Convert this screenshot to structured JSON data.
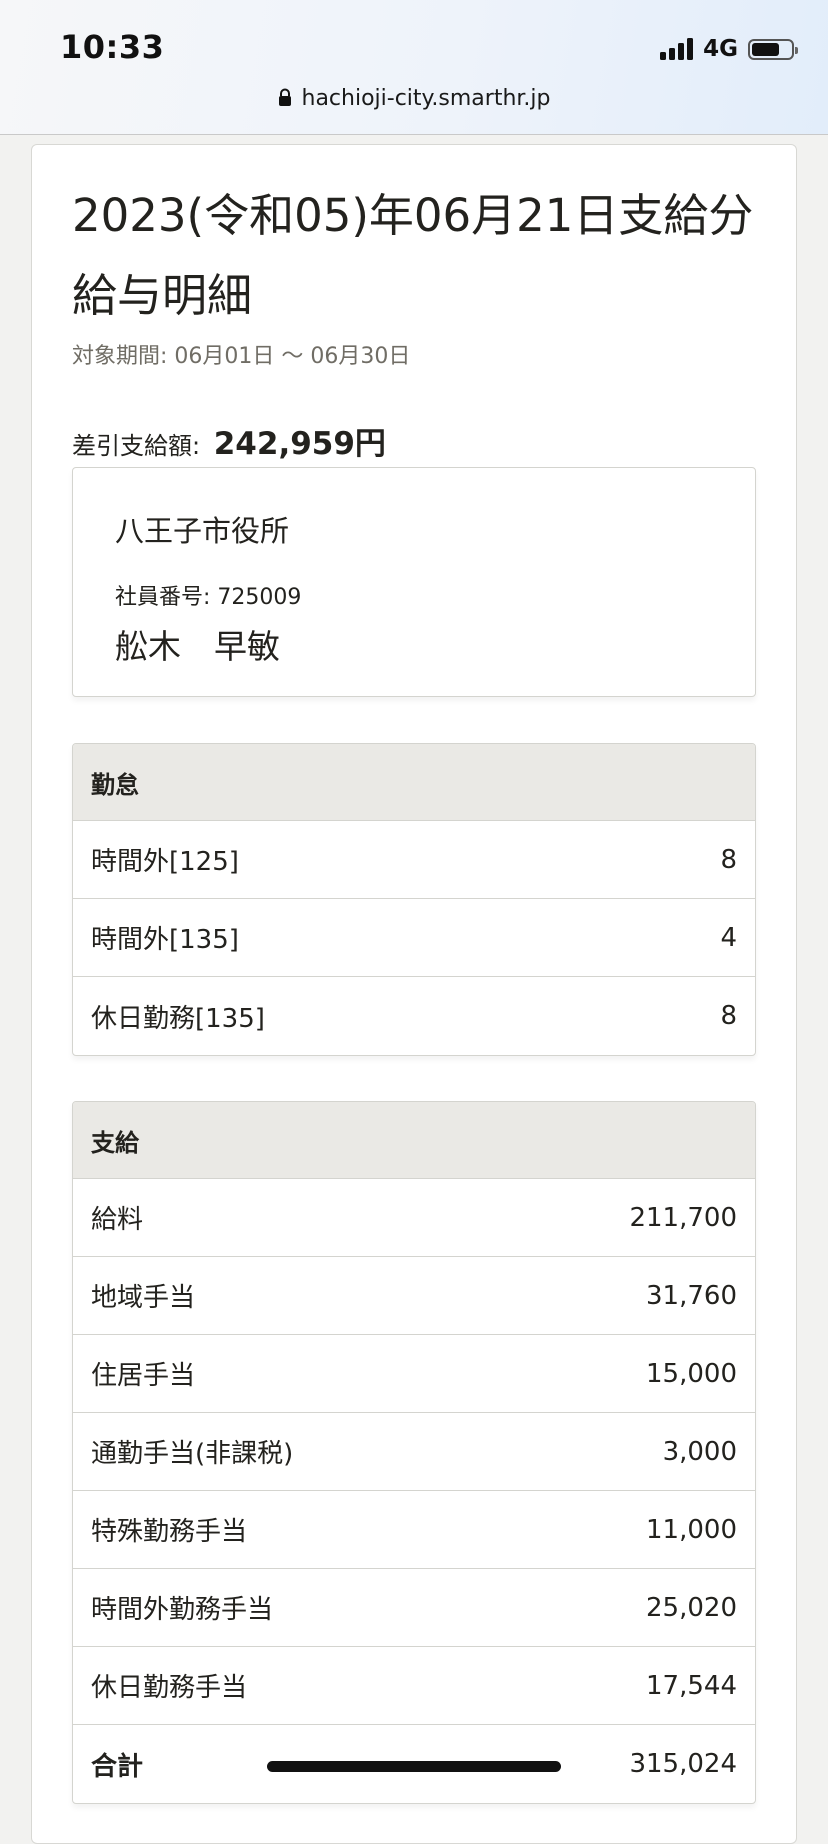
{
  "status_bar": {
    "time": "10:33",
    "network": "4G",
    "signal_icon": "signal-bars-icon",
    "battery_icon": "battery-icon",
    "battery_level": 0.7
  },
  "browser": {
    "url": "hachioji-city.smarthr.jp",
    "lock_icon": "lock-icon"
  },
  "payslip": {
    "title": "2023(令和05)年06月21日支給分 給与明細",
    "period_label": "対象期間: 06月01日 〜 06月30日",
    "net_pay_label": "差引支給額:",
    "net_pay_amount": "242,959円"
  },
  "employee": {
    "organization": "八王子市役所",
    "employee_number": "社員番号: 725009",
    "name": "舩木　早敏"
  },
  "attendance": {
    "heading": "勤怠",
    "rows": [
      {
        "label": "時間外[125]",
        "value": "8"
      },
      {
        "label": "時間外[135]",
        "value": "4"
      },
      {
        "label": "休日勤務[135]",
        "value": "8"
      }
    ]
  },
  "payments": {
    "heading": "支給",
    "rows": [
      {
        "label": "給料",
        "value": "211,700"
      },
      {
        "label": "地域手当",
        "value": "31,760"
      },
      {
        "label": "住居手当",
        "value": "15,000"
      },
      {
        "label": "通勤手当(非課税)",
        "value": "3,000"
      },
      {
        "label": "特殊勤務手当",
        "value": "11,000"
      },
      {
        "label": "時間外勤務手当",
        "value": "25,020"
      },
      {
        "label": "休日勤務手当",
        "value": "17,544"
      },
      {
        "label": "合計",
        "value": "315,024"
      }
    ]
  },
  "colors": {
    "text": "#23221e",
    "muted_text": "#706d65",
    "table_header_bg": "#eae9e5",
    "border": "#d4d4cf",
    "page_bg": "#f2f2f0"
  }
}
